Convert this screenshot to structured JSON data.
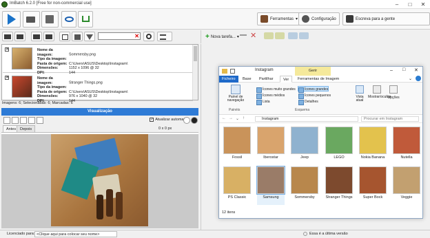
{
  "window": {
    "title": "ImBatch 6.2.0 [Free for non-commercial use]"
  },
  "toolbar": {
    "ferramentas": "Ferramentas",
    "configuracao": "Configuração",
    "escreva": "Escreva para a gente"
  },
  "tasks": {
    "new_task": "Nova tarefa..."
  },
  "files": [
    {
      "name_label": "Nome da imagem:",
      "name": "Sommersby.png",
      "type_label": "Tipo da imagem:",
      "type": "",
      "path_label": "Pasta de origem:",
      "path": "C:\\Users\\ASUS\\Desktop\\Instagram\\",
      "dim_label": "Dimensões:",
      "dim": "1152 x 1096 @ 32",
      "dpi_label": "DPI:",
      "dpi": "144"
    },
    {
      "name_label": "Nome da imagem:",
      "name": "Stranger Things.png",
      "type_label": "Tipo da imagem:",
      "type": "",
      "path_label": "Pasta de origem:",
      "path": "C:\\Users\\ASUS\\Desktop\\Instagram\\",
      "dim_label": "Dimensões:",
      "dim": "976 x 1040 @ 32",
      "dpi_label": "DPI:",
      "dpi": "144"
    }
  ],
  "counts": "Imagens: 6; Selecionadas: 6; Marcadas: 6",
  "preview": {
    "header": "Visualização",
    "auto_update": "Atualizar automatic",
    "tab_before": "Antes",
    "tab_after": "Depois",
    "coords": "0 x 0 px"
  },
  "explorer": {
    "title": "Instagram",
    "gerir": "Gerir",
    "tabs": [
      "Ficheiro",
      "Base",
      "Partilhar",
      "Ver",
      "Ferramentas de Imagem"
    ],
    "panes_label": "Painel de navegação",
    "panes_group": "Painéis",
    "layout_group": "Esquema",
    "layout_options": [
      "Ícones muito grandes",
      "Ícones médios",
      "Lista",
      "Ícones grandes",
      "Ícones pequenos",
      "Detalhes"
    ],
    "vista_atual": "Vista atual",
    "mostrar_ocultar": "Mostrar/ocultar",
    "opcoes": "Opções",
    "address": "Instagram",
    "search_placeholder": "Procurar em Instagram",
    "items": [
      {
        "label": "Fossil",
        "color": "#c9935a"
      },
      {
        "label": "Iberostar",
        "color": "#d9a46d"
      },
      {
        "label": "Jeep",
        "color": "#8fb2cf"
      },
      {
        "label": "LEGO",
        "color": "#6aa860"
      },
      {
        "label": "Nokia Banana",
        "color": "#e3c24d"
      },
      {
        "label": "Nutella",
        "color": "#c05a3a"
      },
      {
        "label": "PS Classic",
        "color": "#d8b064"
      },
      {
        "label": "Samsung",
        "color": "#9a7c68"
      },
      {
        "label": "Sommersby",
        "color": "#b8874c"
      },
      {
        "label": "Stranger Things",
        "color": "#7d4a2e"
      },
      {
        "label": "Super Bock",
        "color": "#a6552f"
      },
      {
        "label": "Veggie",
        "color": "#c2a070"
      }
    ],
    "status": "12 itens"
  },
  "statusbar": {
    "licensed": "Licenciado para:",
    "placeholder": "<Clique aqui para colocar seu nome>",
    "version": "Essa é a última versão"
  }
}
